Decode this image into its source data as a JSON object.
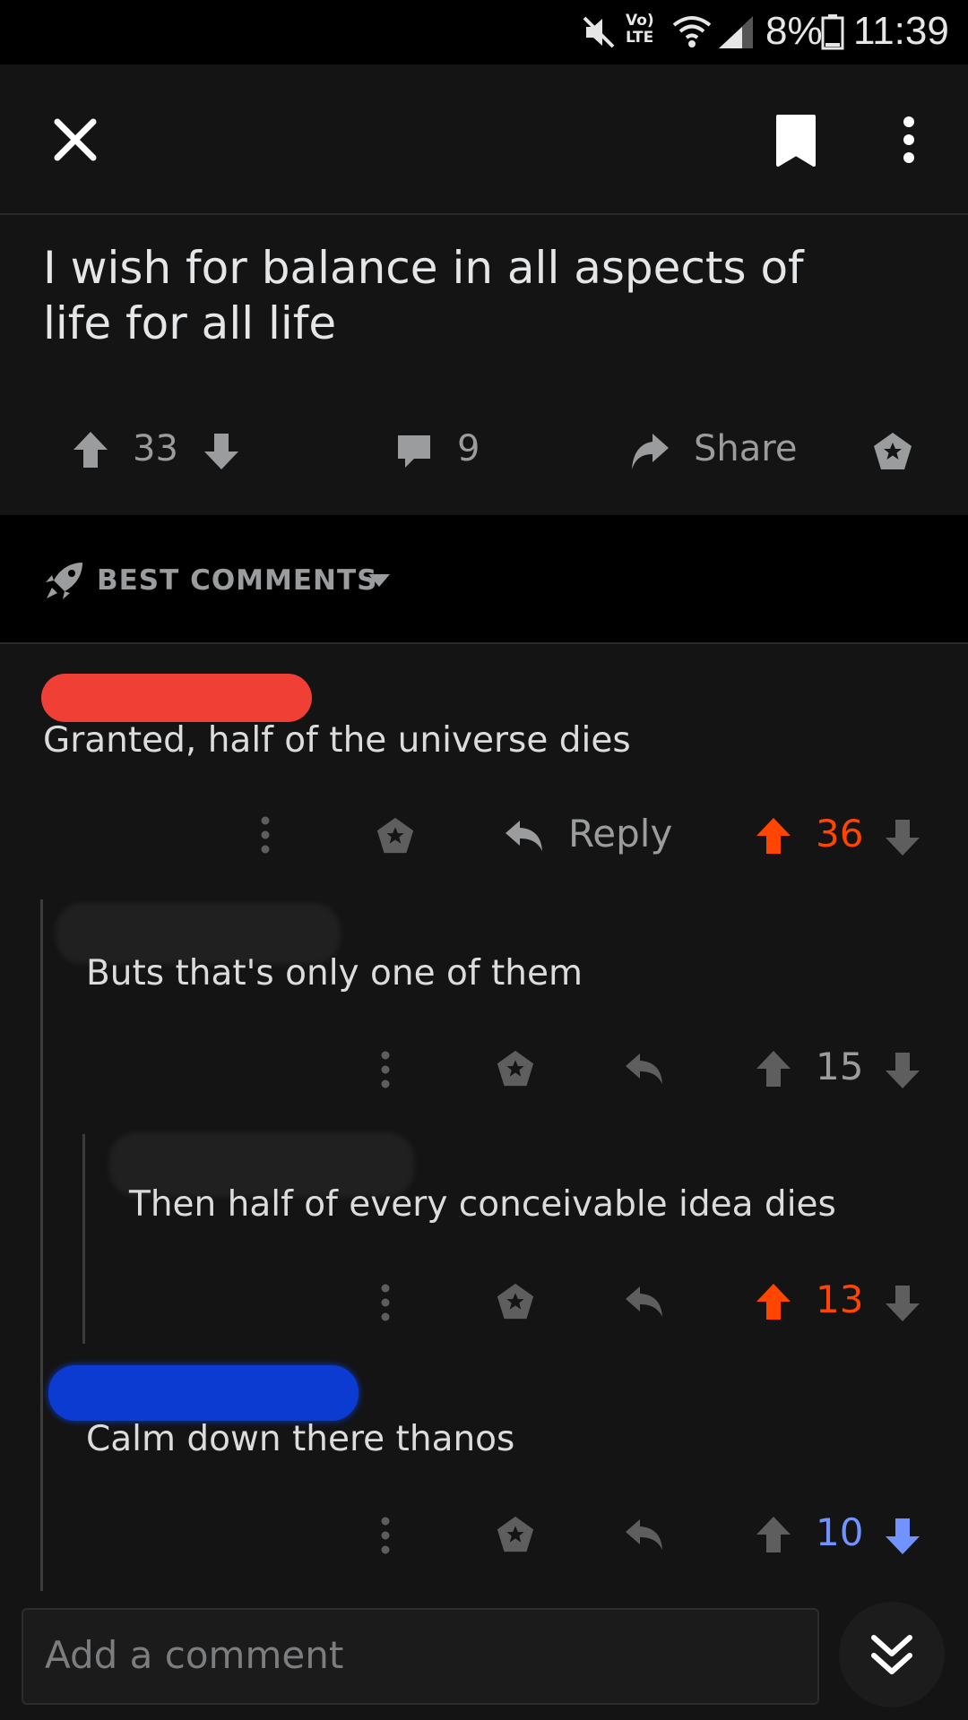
{
  "status_bar": {
    "battery": "8%",
    "time": "11:39",
    "network": "Vo) LTE"
  },
  "post": {
    "title": "I wish for balance in all aspects of life for all life",
    "score": "33",
    "comment_count": "9",
    "share_label": "Share"
  },
  "sort": {
    "label": "BEST COMMENTS"
  },
  "comments": [
    {
      "text": "Granted, half of the universe dies",
      "reply_label": "Reply",
      "score": "36",
      "vote": "up"
    },
    {
      "text": "Buts that's only one of them",
      "score": "15",
      "vote": "none"
    },
    {
      "text": "Then half of every conceivable idea dies",
      "score": "13",
      "vote": "up"
    },
    {
      "text": "Calm down there thanos",
      "score": "10",
      "vote": "down"
    }
  ],
  "composer": {
    "placeholder": "Add a comment"
  },
  "colors": {
    "upvote": "#ff4500",
    "downvote": "#7193ff",
    "neutral": "#9a9c9e",
    "background": "#141414"
  }
}
